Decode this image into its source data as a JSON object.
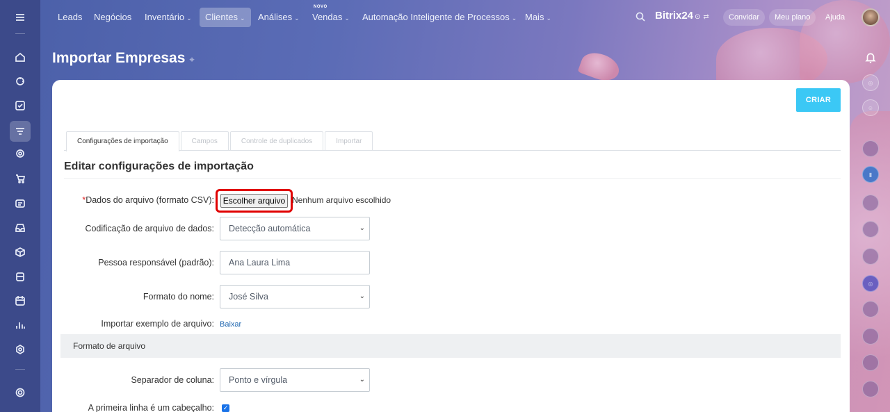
{
  "topnav": {
    "items": [
      {
        "label": "Leads",
        "chevron": false
      },
      {
        "label": "Negócios",
        "chevron": false
      },
      {
        "label": "Inventário",
        "chevron": true
      },
      {
        "label": "Clientes",
        "chevron": true,
        "active": true
      },
      {
        "label": "Análises",
        "chevron": true
      },
      {
        "label": "Vendas",
        "chevron": true,
        "badge": "NOVO"
      },
      {
        "label": "Automação Inteligente de Processos",
        "chevron": true
      },
      {
        "label": "Mais",
        "chevron": true
      }
    ],
    "brand": "Bitrix24",
    "invite": "Convidar",
    "plan": "Meu plano",
    "help": "Ajuda"
  },
  "page": {
    "title": "Importar Empresas"
  },
  "card": {
    "create_label": "CRIAR",
    "tabs": [
      {
        "label": "Configurações de importação",
        "active": true
      },
      {
        "label": "Campos",
        "active": false
      },
      {
        "label": "Controle de duplicados",
        "active": false
      },
      {
        "label": "Importar",
        "active": false
      }
    ],
    "section_title": "Editar configurações de importação",
    "form": {
      "file_label_required": "*",
      "file_label": "Dados do arquivo (formato CSV):",
      "file_button": "Escolher arquivo",
      "file_status": "Nenhum arquivo escolhido",
      "encoding_label": "Codificação de arquivo de dados:",
      "encoding_value": "Detecção automática",
      "responsible_label": "Pessoa responsável (padrão):",
      "responsible_value": "Ana Laura Lima",
      "name_format_label": "Formato do nome:",
      "name_format_value": "José Silva",
      "sample_label": "Importar exemplo de arquivo:",
      "sample_link": "Baixar"
    },
    "file_format_header": "Formato de arquivo",
    "format": {
      "separator_label": "Separador de coluna:",
      "separator_value": "Ponto e vírgula",
      "header_row_label": "A primeira linha é um cabeçalho:",
      "header_row_checked": true
    }
  },
  "colors": {
    "accent": "#3bc8f5",
    "link": "#2067b0",
    "highlight": "#e00000"
  }
}
